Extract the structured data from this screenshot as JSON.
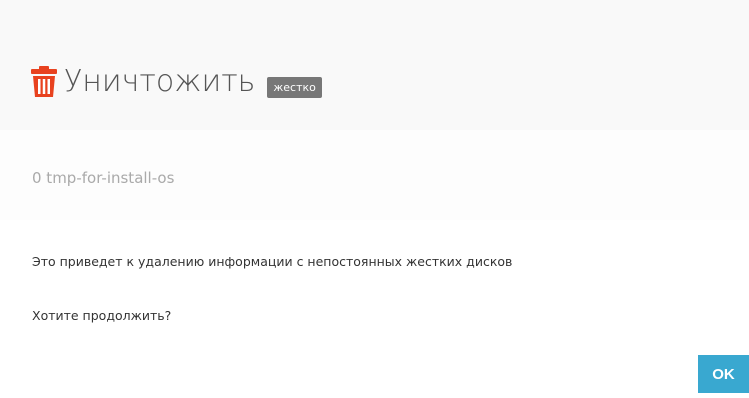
{
  "dialog": {
    "title": "Уничтожить",
    "badge": "жестко",
    "target": "0 tmp-for-install-os",
    "message": "Это приведет к удалению информации с непостоянных жестких дисков",
    "question": "Хотите продолжить?",
    "ok_label": "OK",
    "icon": "trash-icon"
  },
  "colors": {
    "icon": "#e8421f",
    "badge_bg": "#777777",
    "ok_bg": "#39a8d0"
  }
}
